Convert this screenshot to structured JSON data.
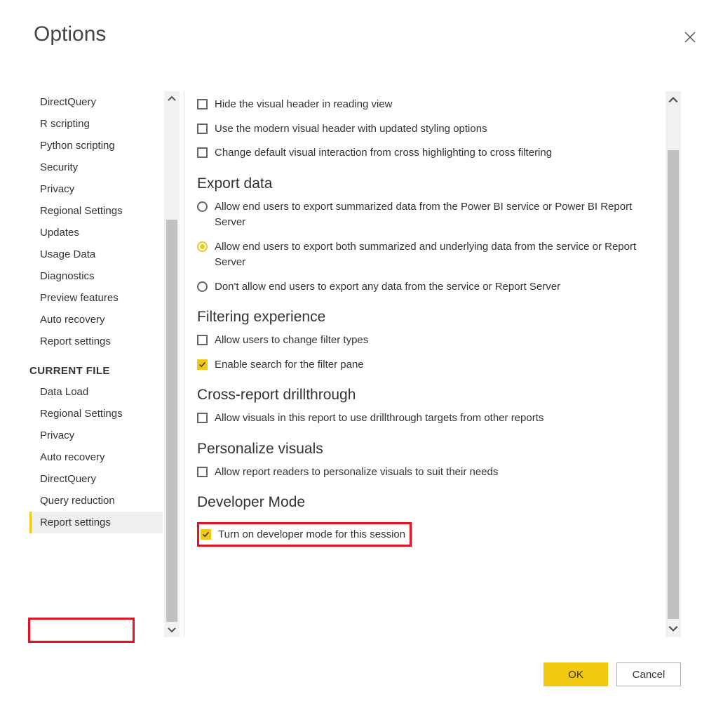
{
  "dialog": {
    "title": "Options"
  },
  "sidebar": {
    "global_items": [
      "DirectQuery",
      "R scripting",
      "Python scripting",
      "Security",
      "Privacy",
      "Regional Settings",
      "Updates",
      "Usage Data",
      "Diagnostics",
      "Preview features",
      "Auto recovery",
      "Report settings"
    ],
    "group_header": "CURRENT FILE",
    "current_file_items": [
      "Data Load",
      "Regional Settings",
      "Privacy",
      "Auto recovery",
      "DirectQuery",
      "Query reduction",
      "Report settings"
    ],
    "selected": "Report settings"
  },
  "content": {
    "visual_checks": [
      "Hide the visual header in reading view",
      "Use the modern visual header with updated styling options",
      "Change default visual interaction from cross highlighting to cross filtering"
    ],
    "export": {
      "heading": "Export data",
      "options": [
        "Allow end users to export summarized data from the Power BI service or Power BI Report Server",
        "Allow end users to export both summarized and underlying data from the service or Report Server",
        "Don't allow end users to export any data from the service or Report Server"
      ],
      "selected_index": 1
    },
    "filtering": {
      "heading": "Filtering experience",
      "allow_change": "Allow users to change filter types",
      "enable_search": "Enable search for the filter pane"
    },
    "drillthrough": {
      "heading": "Cross-report drillthrough",
      "option": "Allow visuals in this report to use drillthrough targets from other reports"
    },
    "personalize": {
      "heading": "Personalize visuals",
      "option": "Allow report readers to personalize visuals to suit their needs"
    },
    "developer": {
      "heading": "Developer Mode",
      "option": "Turn on developer mode for this session"
    }
  },
  "footer": {
    "ok": "OK",
    "cancel": "Cancel"
  },
  "colors": {
    "accent": "#F2C811",
    "highlight": "#E81123"
  }
}
